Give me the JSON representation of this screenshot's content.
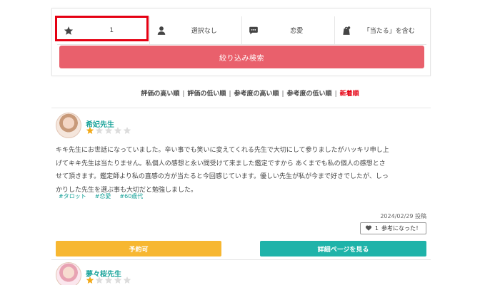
{
  "filters": {
    "rating": "1",
    "category_person": "選択なし",
    "genre": "恋愛",
    "keyword": "「当たる」を含む",
    "search_label": "絞り込み検索"
  },
  "sort": {
    "items": [
      "評価の高い順",
      "評価の低い順",
      "参考度の高い順",
      "参考度の低い順",
      "新着順"
    ],
    "active_index": 4,
    "separator": "|"
  },
  "reviews": [
    {
      "name": "希妃先生",
      "rating": 1,
      "max_rating": 5,
      "lines": [
        "キキ先生にお世話になっていました。辛い事でも笑いに変えてくれる先生で大切にして参りましたがハッキリ申し上",
        "げてキキ先生は当たりません。私個人の感想と永い間受けて来ました鑑定ですから あくまでも私の個人の感想とさ",
        "せて頂きます。鑑定師より私の直感の方が当たると今回感じています。優しい先生が私が今まで好きでしたが、しっ",
        "かりした先生を選ぶ事も大切だと勉強しました。"
      ],
      "tags": [
        "#タロット",
        "#恋愛",
        "#60歳代"
      ],
      "posted": "2024/02/29 投稿",
      "helpful_count": "1",
      "helpful_label": "参考になった！",
      "reserve_label": "予約可",
      "detail_label": "詳細ページを見る"
    },
    {
      "name": "夢々桜先生",
      "rating": 1,
      "max_rating": 5
    }
  ],
  "colors": {
    "accent_red": "#e50012",
    "search_btn": "#e9606c",
    "teal": "#1aa39a",
    "star_filled": "#f2a918",
    "star_empty": "#dcdcdc",
    "reserve": "#f7b731",
    "detail": "#1fb3a9"
  }
}
